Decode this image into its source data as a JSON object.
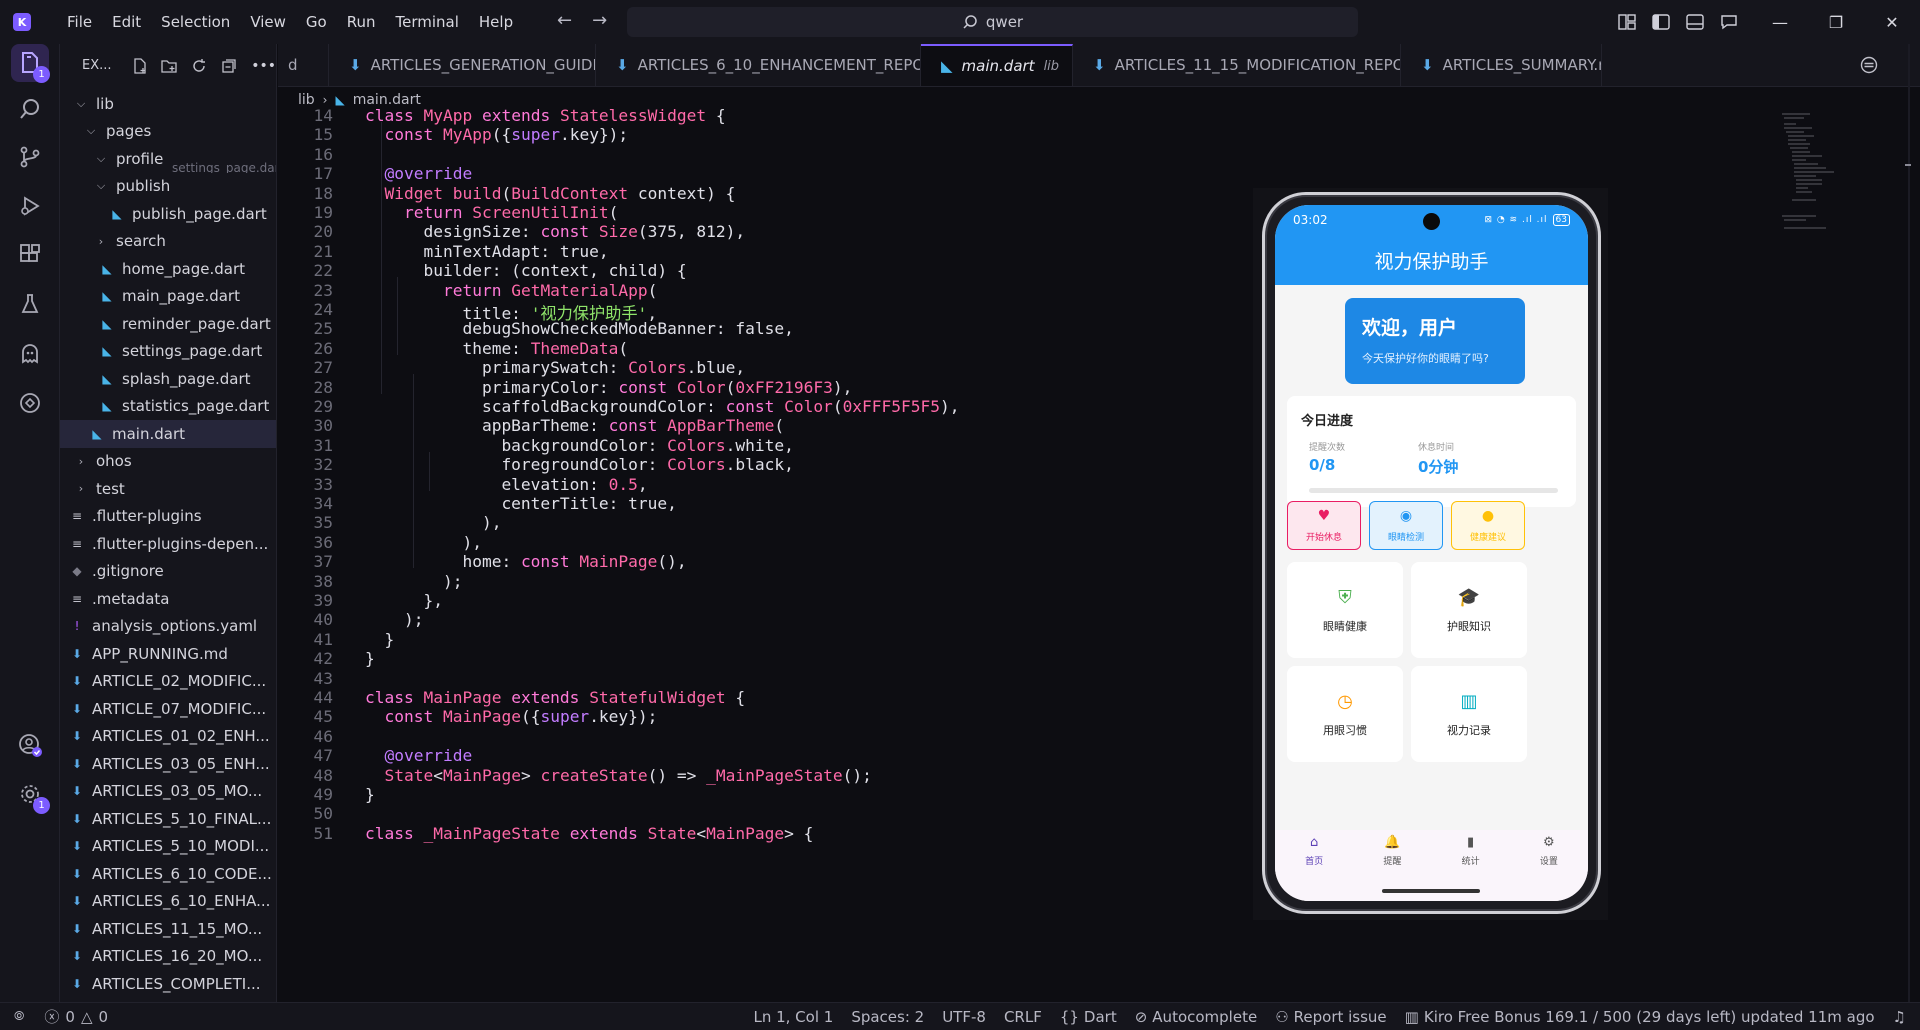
{
  "titlebar": {
    "menu": [
      "File",
      "Edit",
      "Selection",
      "View",
      "Go",
      "Run",
      "Terminal",
      "Help"
    ],
    "search_text": "qwer"
  },
  "activity_bar": {
    "explorer_badge": "1",
    "settings_badge": "1"
  },
  "explorer": {
    "title": "EX...",
    "items": [
      {
        "label": "lib",
        "indent": 0,
        "kind": "folder-open"
      },
      {
        "label": "pages",
        "indent": 1,
        "kind": "folder-open"
      },
      {
        "label": "profile",
        "indent": 2,
        "kind": "folder-open",
        "ghost": "settings_page.dart"
      },
      {
        "label": "publish",
        "indent": 2,
        "kind": "folder-open"
      },
      {
        "label": "publish_page.dart",
        "indent": 3,
        "kind": "dart"
      },
      {
        "label": "search",
        "indent": 2,
        "kind": "folder-closed"
      },
      {
        "label": "home_page.dart",
        "indent": 2,
        "kind": "dart"
      },
      {
        "label": "main_page.dart",
        "indent": 2,
        "kind": "dart"
      },
      {
        "label": "reminder_page.dart",
        "indent": 2,
        "kind": "dart"
      },
      {
        "label": "settings_page.dart",
        "indent": 2,
        "kind": "dart"
      },
      {
        "label": "splash_page.dart",
        "indent": 2,
        "kind": "dart"
      },
      {
        "label": "statistics_page.dart",
        "indent": 2,
        "kind": "dart"
      },
      {
        "label": "main.dart",
        "indent": 1,
        "kind": "dart",
        "selected": true
      },
      {
        "label": "ohos",
        "indent": 0,
        "kind": "folder-closed"
      },
      {
        "label": "test",
        "indent": 0,
        "kind": "folder-closed"
      },
      {
        "label": ".flutter-plugins",
        "indent": 0,
        "kind": "txt"
      },
      {
        "label": ".flutter-plugins-depen...",
        "indent": 0,
        "kind": "txt"
      },
      {
        "label": ".gitignore",
        "indent": 0,
        "kind": "git"
      },
      {
        "label": ".metadata",
        "indent": 0,
        "kind": "txt"
      },
      {
        "label": "analysis_options.yaml",
        "indent": 0,
        "kind": "yaml"
      },
      {
        "label": "APP_RUNNING.md",
        "indent": 0,
        "kind": "md"
      },
      {
        "label": "ARTICLE_02_MODIFIC...",
        "indent": 0,
        "kind": "md"
      },
      {
        "label": "ARTICLE_07_MODIFIC...",
        "indent": 0,
        "kind": "md"
      },
      {
        "label": "ARTICLES_01_02_ENH...",
        "indent": 0,
        "kind": "md"
      },
      {
        "label": "ARTICLES_03_05_ENH...",
        "indent": 0,
        "kind": "md"
      },
      {
        "label": "ARTICLES_03_05_MO...",
        "indent": 0,
        "kind": "md"
      },
      {
        "label": "ARTICLES_5_10_FINAL...",
        "indent": 0,
        "kind": "md"
      },
      {
        "label": "ARTICLES_5_10_MODI...",
        "indent": 0,
        "kind": "md"
      },
      {
        "label": "ARTICLES_6_10_CODE...",
        "indent": 0,
        "kind": "md"
      },
      {
        "label": "ARTICLES_6_10_ENHA...",
        "indent": 0,
        "kind": "md"
      },
      {
        "label": "ARTICLES_11_15_MO...",
        "indent": 0,
        "kind": "md"
      },
      {
        "label": "ARTICLES_16_20_MO...",
        "indent": 0,
        "kind": "md"
      },
      {
        "label": "ARTICLES_COMPLETI...",
        "indent": 0,
        "kind": "md"
      }
    ]
  },
  "tabs": [
    {
      "label": "d",
      "kind": "partial"
    },
    {
      "label": "ARTICLES_GENERATION_GUIDE.md",
      "kind": "md"
    },
    {
      "label": "ARTICLES_6_10_ENHANCEMENT_REPORT.md",
      "kind": "md"
    },
    {
      "label": "main.dart",
      "sub": "lib",
      "kind": "dart",
      "active": true
    },
    {
      "label": "ARTICLES_11_15_MODIFICATION_REPORT.md",
      "kind": "md"
    },
    {
      "label": "ARTICLES_SUMMARY.md",
      "kind": "md"
    }
  ],
  "breadcrumb": {
    "folder": "lib",
    "file": "main.dart"
  },
  "code_lines": [
    {
      "n": "14",
      "html": "<span class='k'>class</span> <span class='cls'>MyApp</span> <span class='k'>extends</span> <span class='cls'>StatelessWidget</span> {"
    },
    {
      "n": "15",
      "html": "  <span class='k'>const</span> <span class='fn'>MyApp</span>({<span class='kw2'>super</span>.key});"
    },
    {
      "n": "16",
      "html": ""
    },
    {
      "n": "17",
      "html": "  <span class='ann'>@override</span>"
    },
    {
      "n": "18",
      "html": "  <span class='cls'>Widget</span> <span class='fn'>build</span>(<span class='cls'>BuildContext</span> context) {"
    },
    {
      "n": "19",
      "html": "    <span class='k'>return</span> <span class='fn'>ScreenUtilInit</span>("
    },
    {
      "n": "20",
      "html": "      designSize: <span class='k'>const</span> <span class='fn'>Size</span>(375, 812),"
    },
    {
      "n": "21",
      "html": "      minTextAdapt: true,"
    },
    {
      "n": "22",
      "html": "      builder: (context, child) {"
    },
    {
      "n": "23",
      "html": "        <span class='k'>return</span> <span class='fn'>GetMaterialApp</span>("
    },
    {
      "n": "24",
      "html": "          title: <span class='str'>'视力保护助手'</span>,"
    },
    {
      "n": "25",
      "html": "          debugShowCheckedModeBanner: false,"
    },
    {
      "n": "26",
      "html": "          theme: <span class='fn'>ThemeData</span>("
    },
    {
      "n": "27",
      "html": "            primarySwatch: <span class='cls'>Colors</span>.blue,"
    },
    {
      "n": "28",
      "html": "            primaryColor: <span class='k'>const</span> <span class='fn'>Color</span>(<span class='num'>0xFF2196F3</span>),"
    },
    {
      "n": "29",
      "html": "            scaffoldBackgroundColor: <span class='k'>const</span> <span class='fn'>Color</span>(<span class='num'>0xFFF5F5F5</span>),"
    },
    {
      "n": "30",
      "html": "            appBarTheme: <span class='k'>const</span> <span class='fn'>AppBarTheme</span>("
    },
    {
      "n": "31",
      "html": "              backgroundColor: <span class='cls'>Colors</span>.white,"
    },
    {
      "n": "32",
      "html": "              foregroundColor: <span class='cls'>Colors</span>.black,"
    },
    {
      "n": "33",
      "html": "              elevation: <span class='num'>0.5</span>,"
    },
    {
      "n": "34",
      "html": "              centerTitle: true,"
    },
    {
      "n": "35",
      "html": "            ),"
    },
    {
      "n": "36",
      "html": "          ),"
    },
    {
      "n": "37",
      "html": "          home: <span class='k'>const</span> <span class='fn'>MainPage</span>(),"
    },
    {
      "n": "38",
      "html": "        );"
    },
    {
      "n": "39",
      "html": "      },"
    },
    {
      "n": "40",
      "html": "    );"
    },
    {
      "n": "41",
      "html": "  }"
    },
    {
      "n": "42",
      "html": "}"
    },
    {
      "n": "43",
      "html": ""
    },
    {
      "n": "44",
      "html": "<span class='k'>class</span> <span class='cls'>MainPage</span> <span class='k'>extends</span> <span class='cls'>StatefulWidget</span> {"
    },
    {
      "n": "45",
      "html": "  <span class='k'>const</span> <span class='fn'>MainPage</span>({<span class='kw2'>super</span>.key});"
    },
    {
      "n": "46",
      "html": ""
    },
    {
      "n": "47",
      "html": "  <span class='ann'>@override</span>"
    },
    {
      "n": "48",
      "html": "  <span class='cls'>State</span>&lt;<span class='cls'>MainPage</span>&gt; <span class='fn'>createState</span>() =&gt; <span class='fn'>_MainPageState</span>();"
    },
    {
      "n": "49",
      "html": "}"
    },
    {
      "n": "50",
      "html": ""
    },
    {
      "n": "51",
      "html": "<span class='k'>class</span> <span class='cls'>_MainPageState</span> <span class='k'>extends</span> <span class='cls'>State</span>&lt;<span class='cls'>MainPage</span>&gt; {"
    }
  ],
  "phone": {
    "time": "03:02",
    "status_icons": "⊠ ◔ ≋ .ıl .ıl",
    "battery": "63",
    "app_title": "视力保护助手",
    "welcome_title": "欢迎，用户",
    "welcome_sub": "今天保护好你的眼睛了吗?",
    "progress": {
      "title": "今日进度",
      "label_left": "提醒次数",
      "value_left": "0/8",
      "label_right": "休息时间",
      "value_right": "0分钟",
      "fraction": 0
    },
    "quick": [
      {
        "label": "开始休息",
        "icon": "heart-icon",
        "color": "#e91e63",
        "bg": "#fde7ee"
      },
      {
        "label": "眼睛检测",
        "icon": "eye-icon",
        "color": "#2196f3",
        "bg": "#e3f2fd"
      },
      {
        "label": "健康建议",
        "icon": "lightbulb-icon",
        "color": "#ffc107",
        "bg": "#fff8e1"
      }
    ],
    "tiles": [
      {
        "label": "眼睛健康",
        "icon": "shield-plus-icon",
        "color": "#4caf50"
      },
      {
        "label": "护眼知识",
        "icon": "graduation-cap-icon",
        "color": "#7b1fa2"
      },
      {
        "label": "用眼习惯",
        "icon": "clock-icon",
        "color": "#ff9800"
      },
      {
        "label": "视力记录",
        "icon": "chart-icon",
        "color": "#00acc1"
      }
    ],
    "nav": [
      {
        "label": "首页",
        "icon": "home-icon",
        "active": true
      },
      {
        "label": "提醒",
        "icon": "bell-icon"
      },
      {
        "label": "统计",
        "icon": "bar-chart-icon"
      },
      {
        "label": "设置",
        "icon": "gear-icon"
      }
    ]
  },
  "statusbar": {
    "errors": "0",
    "warnings": "0",
    "position": "Ln 1, Col 1",
    "spaces": "Spaces: 2",
    "encoding": "UTF-8",
    "eol": "CRLF",
    "language": "Dart",
    "autocomplete": "Autocomplete",
    "report": "Report issue",
    "bonus": "Kiro Free Bonus 169.1 / 500 (29 days left) updated 11m ago"
  },
  "colors": {
    "accent": "#7c5cff",
    "app_primary": "#2196f3"
  }
}
